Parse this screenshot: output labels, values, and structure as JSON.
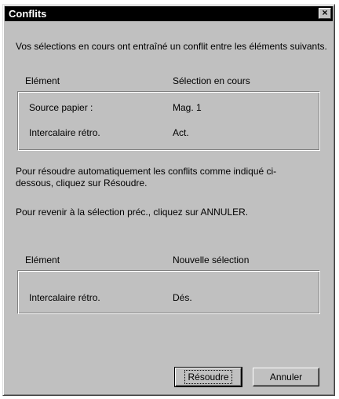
{
  "window": {
    "title": "Conflits",
    "close_glyph": "×"
  },
  "intro_text": "Vos sélections en cours ont entraîné un conflit entre les éléments suivants.",
  "current": {
    "header_element": "Elément",
    "header_selection": "Sélection en cours",
    "rows": [
      {
        "element": "Source papier :",
        "value": "Mag. 1"
      },
      {
        "element": "Intercalaire rétro.",
        "value": "Act."
      }
    ]
  },
  "resolve_text": "Pour résoudre automatiquement les conflits comme indiqué ci-dessous, cliquez sur Résoudre.",
  "cancel_text": "Pour revenir à la sélection préc., cliquez sur ANNULER.",
  "new": {
    "header_element": "Elément",
    "header_selection": "Nouvelle sélection",
    "rows": [
      {
        "element": "Intercalaire rétro.",
        "value": "Dés."
      }
    ]
  },
  "buttons": {
    "resolve_label": "Résoudre",
    "cancel_label": "Annuler"
  }
}
